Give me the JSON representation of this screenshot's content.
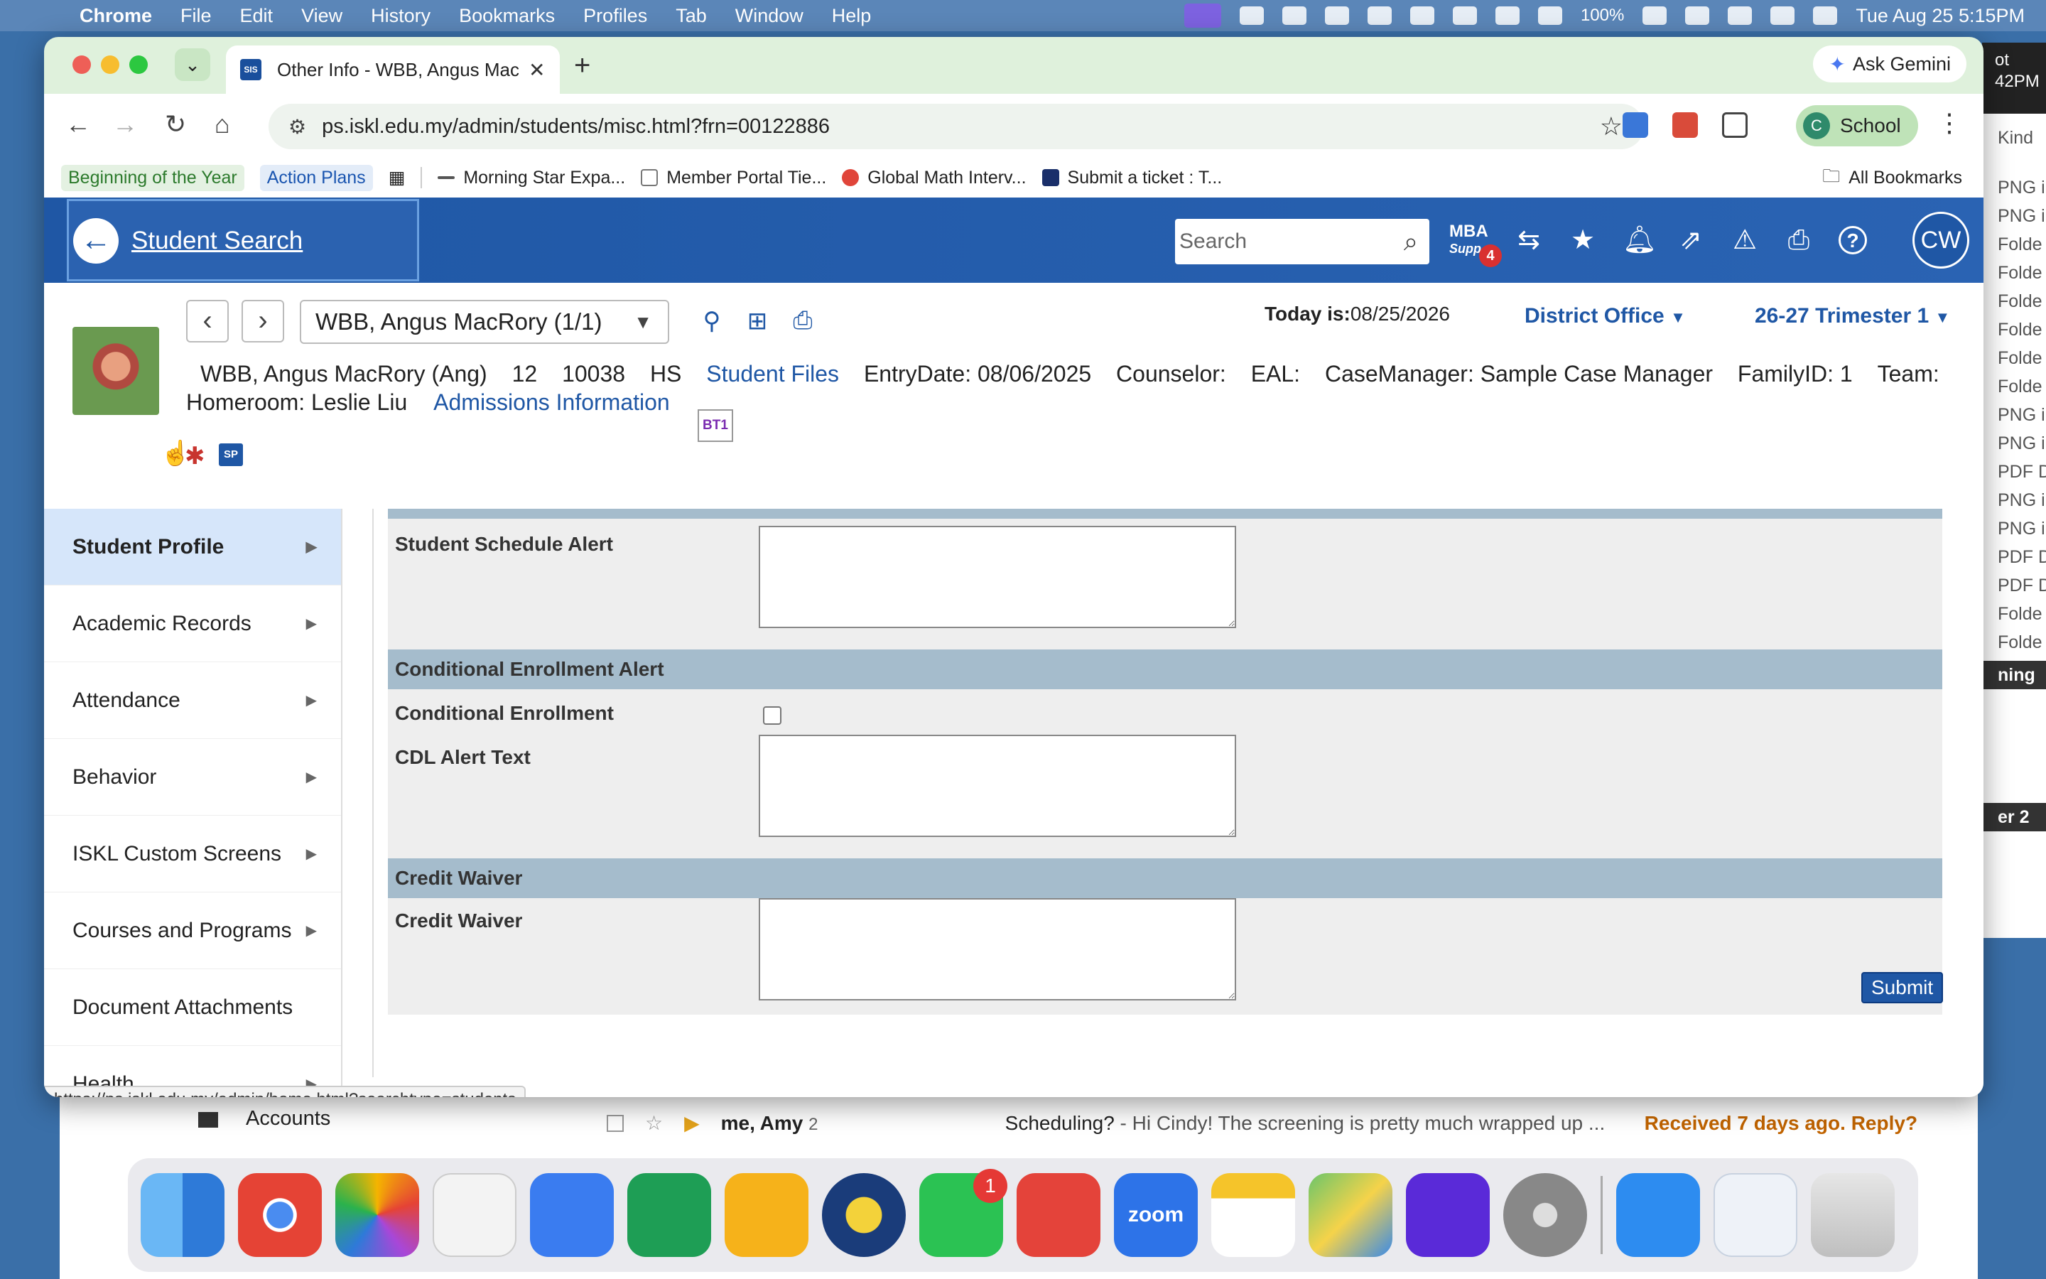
{
  "menubar": {
    "app": "Chrome",
    "items": [
      "File",
      "Edit",
      "View",
      "History",
      "Bookmarks",
      "Profiles",
      "Tab",
      "Window",
      "Help"
    ],
    "battery": "100%",
    "datetime": "Tue Aug 25  5:15PM"
  },
  "chrome": {
    "tab_title": "Other Info - WBB, Angus Mac",
    "tab_favicon": "SIS",
    "ask_gemini": "Ask Gemini",
    "url": "ps.iskl.edu.my/admin/students/misc.html?frn=00122886",
    "profile_initial": "C",
    "profile_name": "School",
    "bookmarks": [
      "Beginning of the Year",
      "Action Plans",
      "Morning Star Expa...",
      "Member Portal Tie...",
      "Global Math Interv...",
      "Submit a ticket : T..."
    ],
    "all_bookmarks": "All Bookmarks",
    "status_url": "https://ps.iskl.edu.my/admin/home.html?searchtype=students"
  },
  "ps": {
    "back_label": "Student Search",
    "search_placeholder": "Search",
    "mba_line1": "MBA",
    "mba_line2": "Supp",
    "mba_badge": "4",
    "avatar": "CW",
    "student_select": "WBB, Angus MacRory  (1/1)",
    "today_label": "Today is:",
    "today_value": "08/25/2026",
    "school": "District Office",
    "term": "26-27 Trimester 1",
    "info": {
      "name": "WBB, Angus MacRory (Ang)",
      "grade": "12",
      "id": "10038",
      "level": "HS",
      "student_files": "Student Files",
      "entry": "EntryDate: 08/06/2025",
      "counselor": "Counselor:",
      "eal": "EAL:",
      "casemanager": "CaseManager: Sample Case Manager",
      "family": "FamilyID: 1",
      "team": "Team:",
      "homeroom": "Homeroom: Leslie Liu",
      "admissions": "Admissions Information",
      "bt1": "BT1",
      "sp": "SP"
    },
    "nav": [
      {
        "label": "Student Profile",
        "active": true,
        "arrow": true
      },
      {
        "label": "Academic Records",
        "arrow": true
      },
      {
        "label": "Attendance",
        "arrow": true
      },
      {
        "label": "Behavior",
        "arrow": true
      },
      {
        "label": "ISKL Custom Screens",
        "arrow": true
      },
      {
        "label": "Courses and Programs",
        "arrow": true
      },
      {
        "label": "Document Attachments",
        "arrow": false
      },
      {
        "label": "Health",
        "arrow": true
      }
    ],
    "form": {
      "schedule_alert_label": "Student Schedule Alert",
      "cond_section": "Conditional Enrollment Alert",
      "cond_label": "Conditional Enrollment",
      "cdl_label": "CDL Alert Text",
      "credit_section": "Credit Waiver",
      "credit_label": "Credit Waiver",
      "submit": "Submit"
    }
  },
  "background": {
    "gmail_account_label": "Accounts",
    "email_sender": "me, Amy",
    "email_count": "2",
    "email_subject": "Scheduling?",
    "email_snippet": " - Hi Cindy! The screening is pretty much wrapped up ...",
    "email_received": "Received 7 days ago. Reply?",
    "drive_rows": [
      "Kind",
      "PNG i",
      "PNG i",
      "Folde",
      "Folde",
      "Folde",
      "Folde",
      "Folde",
      "Folde",
      "PNG i",
      "PNG i",
      "PDF D",
      "PNG i",
      "PNG i",
      "PDF D",
      "PDF D",
      "Folde",
      "Folde"
    ],
    "drive_top": "ot\n42PM",
    "drive_side1": "ning",
    "drive_side2": "er 2"
  },
  "dock": {
    "whatsapp_badge": "1",
    "zoom_label": "zoom"
  },
  "colors": {
    "ps_blue": "#1f57a5",
    "section_header": "#a5bccc",
    "nav_active": "#d6e6fa"
  }
}
